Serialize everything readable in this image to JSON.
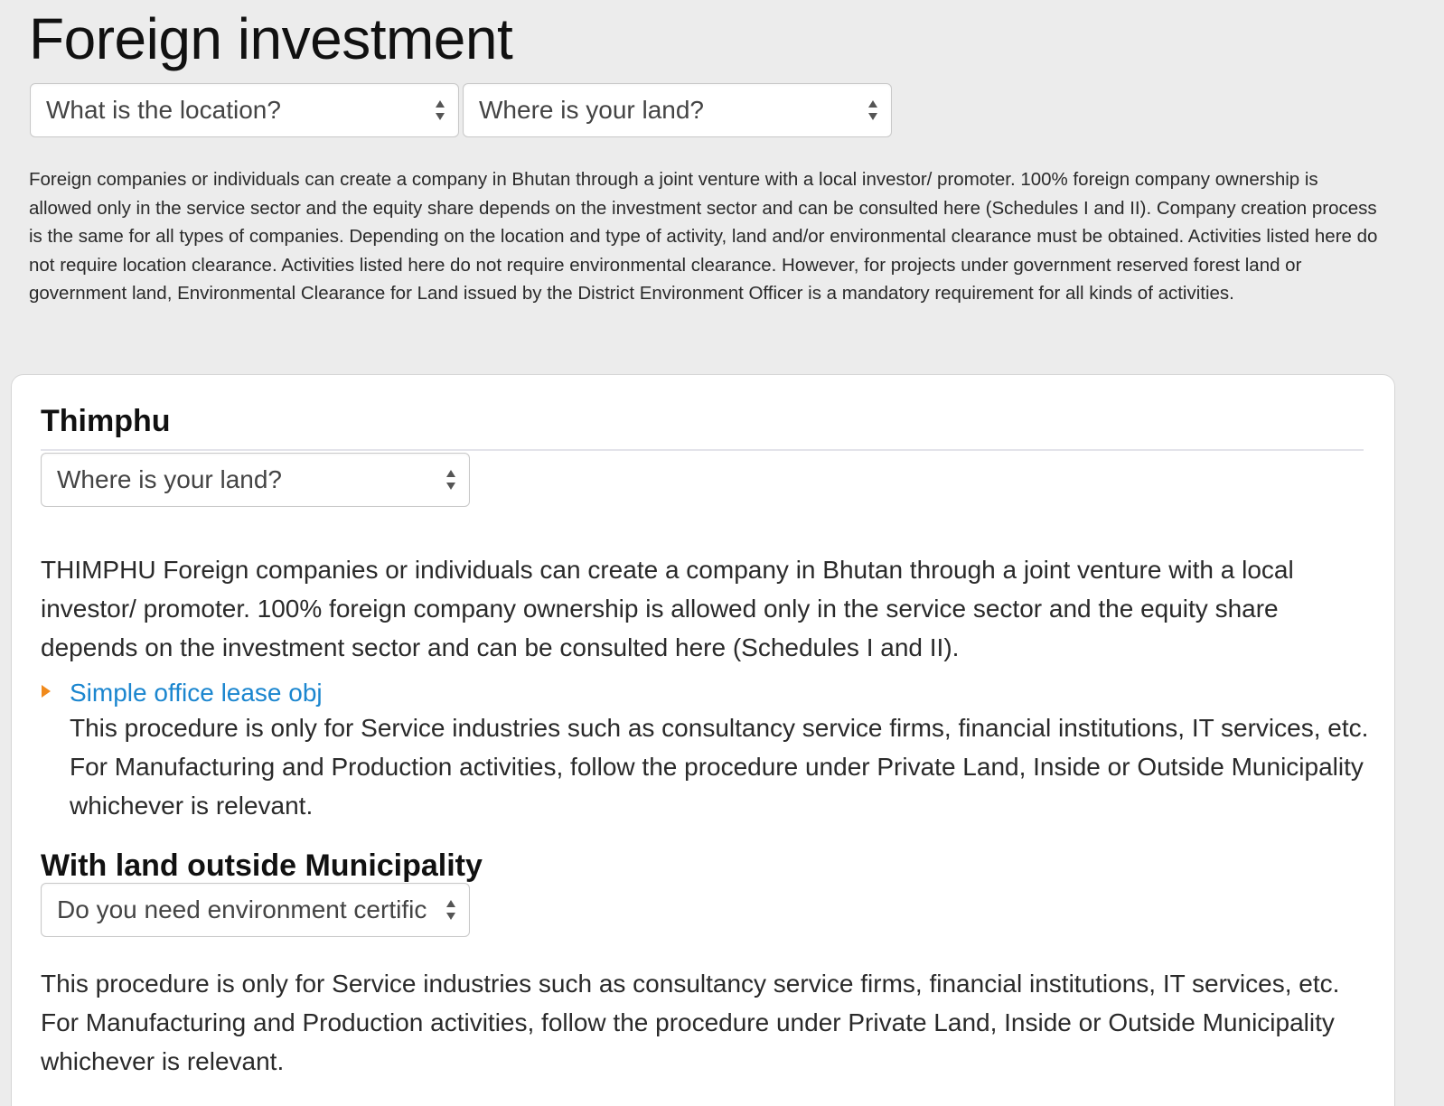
{
  "page": {
    "title": "Foreign investment"
  },
  "filters": {
    "location_select": "What is the location?",
    "land_select": "Where is your land?"
  },
  "intro": {
    "text": "Foreign companies or individuals can create a company in Bhutan through a joint venture with a local investor/ promoter. 100% foreign company ownership is allowed only in the service sector and the equity share depends on the investment sector and can be consulted here (Schedules I and II). Company creation process is the same for all types of companies. Depending on the location and type of activity, land and/or environmental clearance must be obtained. Activities listed here do not require location clearance. Activities listed here do not require environmental clearance. However, for projects under government reserved forest land or government land, Environmental Clearance for Land issued by the District Environment Officer is a mandatory requirement for all kinds of activities."
  },
  "card": {
    "heading": "Thimphu",
    "land_select": "Where is your land?",
    "description": "THIMPHU Foreign companies or individuals can create a company in Bhutan through a joint venture with a local investor/ promoter. 100% foreign company ownership is allowed only in the service sector and the equity share depends on the investment sector and can be consulted here (Schedules I and II).",
    "procedure": {
      "link_label": "Simple office lease obj",
      "description": "This procedure is only for Service industries such as consultancy service firms, financial institutions, IT services, etc. For Manufacturing and Production activities, follow the procedure under Private Land, Inside or Outside Municipality whichever is relevant."
    },
    "section": {
      "heading": "With land outside Municipality",
      "env_select": "Do you need environment certificate?",
      "description": "This procedure is only for Service industries such as consultancy service firms, financial institutions, IT services, etc. For Manufacturing and Production activities, follow the procedure under Private Land, Inside or Outside Municipality whichever is relevant."
    }
  },
  "colors": {
    "background": "#ececec",
    "link": "#1b86cf",
    "caret": "#f08a1c"
  },
  "icons": {
    "select_arrows": "updown-arrows-icon",
    "procedure_caret": "caret-right-icon"
  }
}
